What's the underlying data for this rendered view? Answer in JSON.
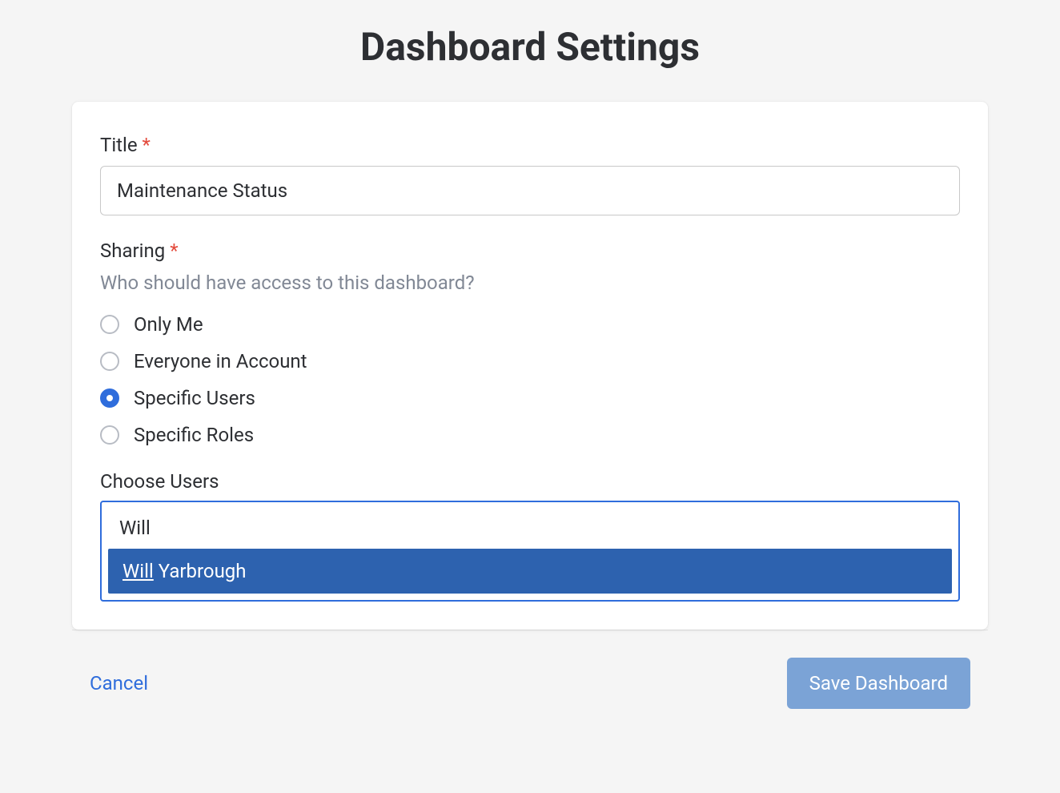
{
  "page": {
    "title": "Dashboard Settings"
  },
  "form": {
    "title_label": "Title",
    "title_value": "Maintenance Status",
    "sharing_label": "Sharing",
    "sharing_help": "Who should have access to this dashboard?",
    "sharing_options": [
      {
        "label": "Only Me",
        "selected": false
      },
      {
        "label": "Everyone in Account",
        "selected": false
      },
      {
        "label": "Specific Users",
        "selected": true
      },
      {
        "label": "Specific Roles",
        "selected": false
      }
    ],
    "choose_users_label": "Choose Users",
    "choose_users_input": "Will",
    "choose_users_suggestion": {
      "match": "Will",
      "rest": " Yarbrough"
    }
  },
  "footer": {
    "cancel_label": "Cancel",
    "save_label": "Save Dashboard"
  }
}
